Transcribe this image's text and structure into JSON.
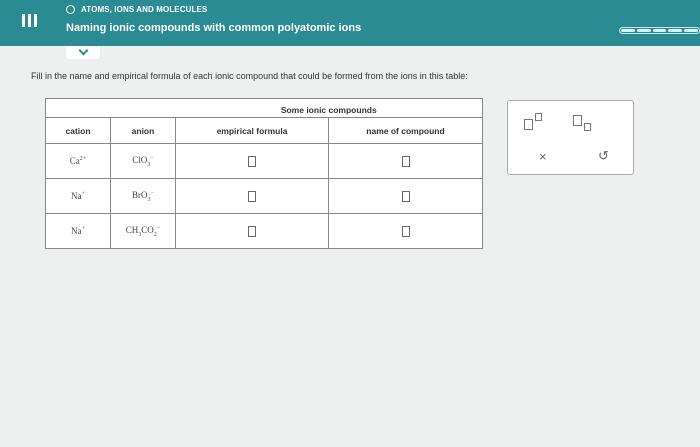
{
  "header": {
    "topic": "ATOMS, IONS AND MOLECULES",
    "title": "Naming ionic compounds with common polyatomic ions"
  },
  "instruction": "Fill in the name and empirical formula of each ionic compound that could be formed from the ions in this table:",
  "table": {
    "caption": "Some ionic compounds",
    "headers": [
      "cation",
      "anion",
      "empirical formula",
      "name of compound"
    ],
    "rows": [
      {
        "cation": "Ca",
        "cation_charge": "2+",
        "anion_base": "ClO",
        "anion_sub": "3",
        "anion_tail": "",
        "anion_tail_sub": "",
        "anion_charge": "−"
      },
      {
        "cation": "Na",
        "cation_charge": "+",
        "anion_base": "BrO",
        "anion_sub": "3",
        "anion_tail": "",
        "anion_tail_sub": "",
        "anion_charge": "−"
      },
      {
        "cation": "Na",
        "cation_charge": "+",
        "anion_base": "CH",
        "anion_sub": "3",
        "anion_tail": "CO",
        "anion_tail_sub": "2",
        "anion_charge": "−"
      }
    ]
  },
  "tools": {
    "clear_symbol": "×",
    "undo_symbol": "↺"
  },
  "colors": {
    "header_bg": "#2a8c92"
  }
}
